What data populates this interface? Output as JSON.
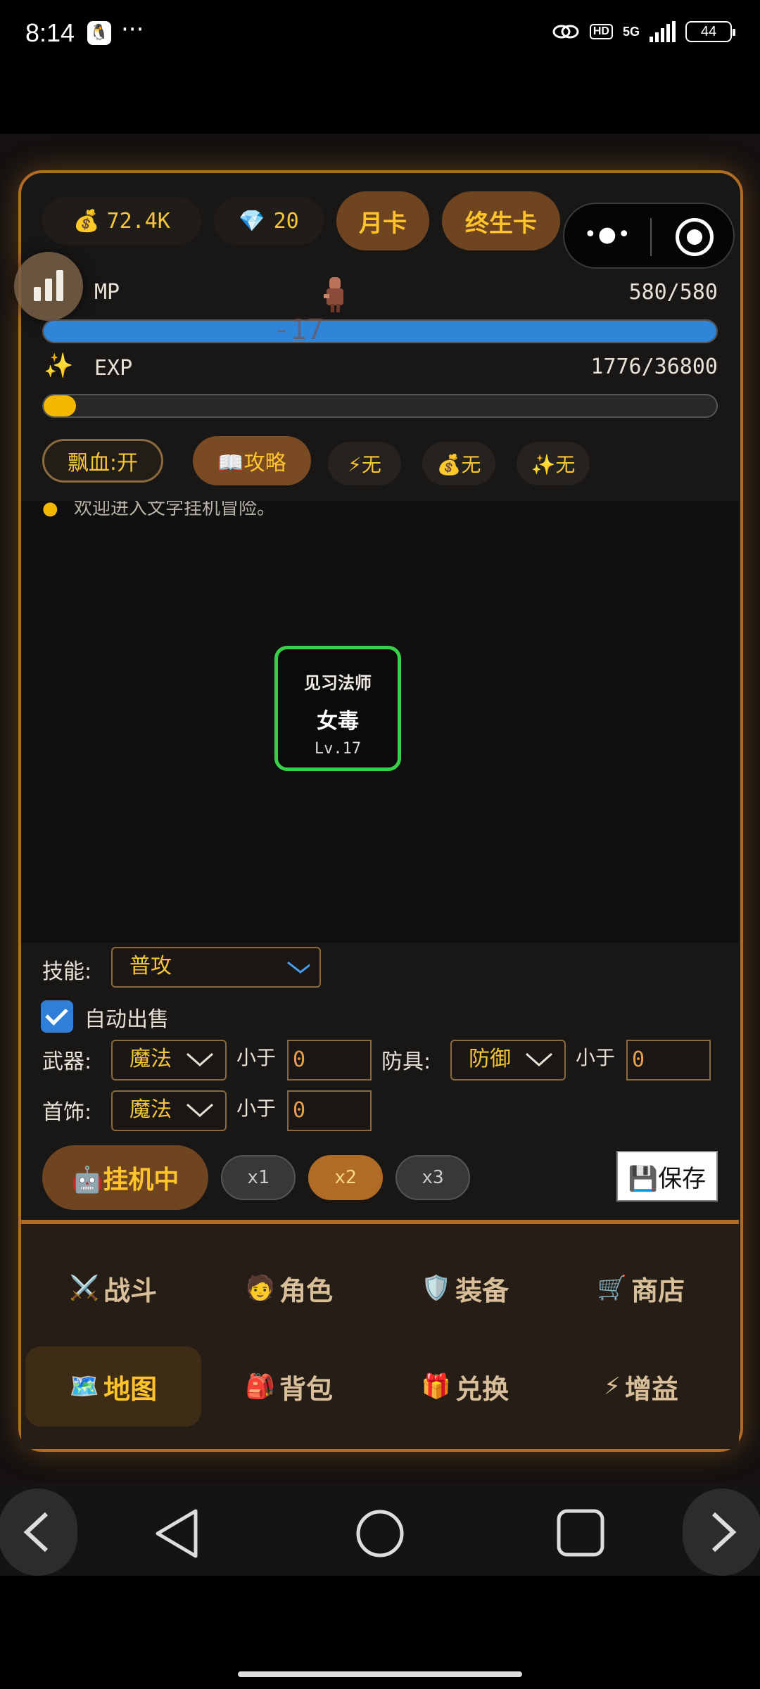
{
  "status_bar": {
    "time": "8:14",
    "qq_icon": "qq-icon",
    "more": "···",
    "hd": "HD",
    "network": "5G",
    "battery": "44"
  },
  "currency": {
    "gold": "72.4K",
    "gold_icon": "money-bag-icon",
    "gems": "20",
    "gem_icon": "diamond-icon",
    "month_card": "月卡",
    "lifetime_card": "终生卡"
  },
  "bars": {
    "mp_label": "MP",
    "mp_value": "580/580",
    "mp_fraction": 1.0,
    "exp_label": "EXP",
    "exp_value": "1776/36800",
    "exp_fraction": 0.048,
    "damage_popup": "-17"
  },
  "tags": {
    "blood": "飘血:开",
    "guide": "📖攻略",
    "speed_buff": "⚡无",
    "gold_buff": "💰无",
    "exp_buff": "✨无"
  },
  "battle": {
    "log_partial": "欢迎进入文字挂机冒险。",
    "enemy_class": "见习法师",
    "enemy_name": "女毒",
    "enemy_level": "Lv.17"
  },
  "controls": {
    "skill_label": "技能:",
    "skill_value": "普攻",
    "auto_sell": "自动出售",
    "weapon_label": "武器:",
    "weapon_value": "魔法",
    "less_than": "小于",
    "weapon_threshold": "0",
    "armor_label": "防具:",
    "armor_value": "防御",
    "armor_threshold": "0",
    "accessory_label": "首饰:",
    "accessory_value": "魔法",
    "accessory_threshold": "0",
    "idle_button": "🤖挂机中",
    "speeds": [
      "x1",
      "x2",
      "x3"
    ],
    "save": "💾保存"
  },
  "nav": {
    "items": [
      {
        "icon": "⚔️",
        "label": "战斗"
      },
      {
        "icon": "🧑",
        "label": "角色"
      },
      {
        "icon": "🛡️",
        "label": "装备"
      },
      {
        "icon": "🛒",
        "label": "商店"
      },
      {
        "icon": "🗺️",
        "label": "地图"
      },
      {
        "icon": "🎒",
        "label": "背包"
      },
      {
        "icon": "🎁",
        "label": "兑换"
      },
      {
        "icon": "⚡",
        "label": "增益"
      }
    ],
    "active": "地图"
  },
  "colors": {
    "accent": "#ffc42a",
    "frame": "#b06b24",
    "mp": "#2f86d8",
    "exp": "#f5b800",
    "enemy_border": "#38d04a"
  }
}
